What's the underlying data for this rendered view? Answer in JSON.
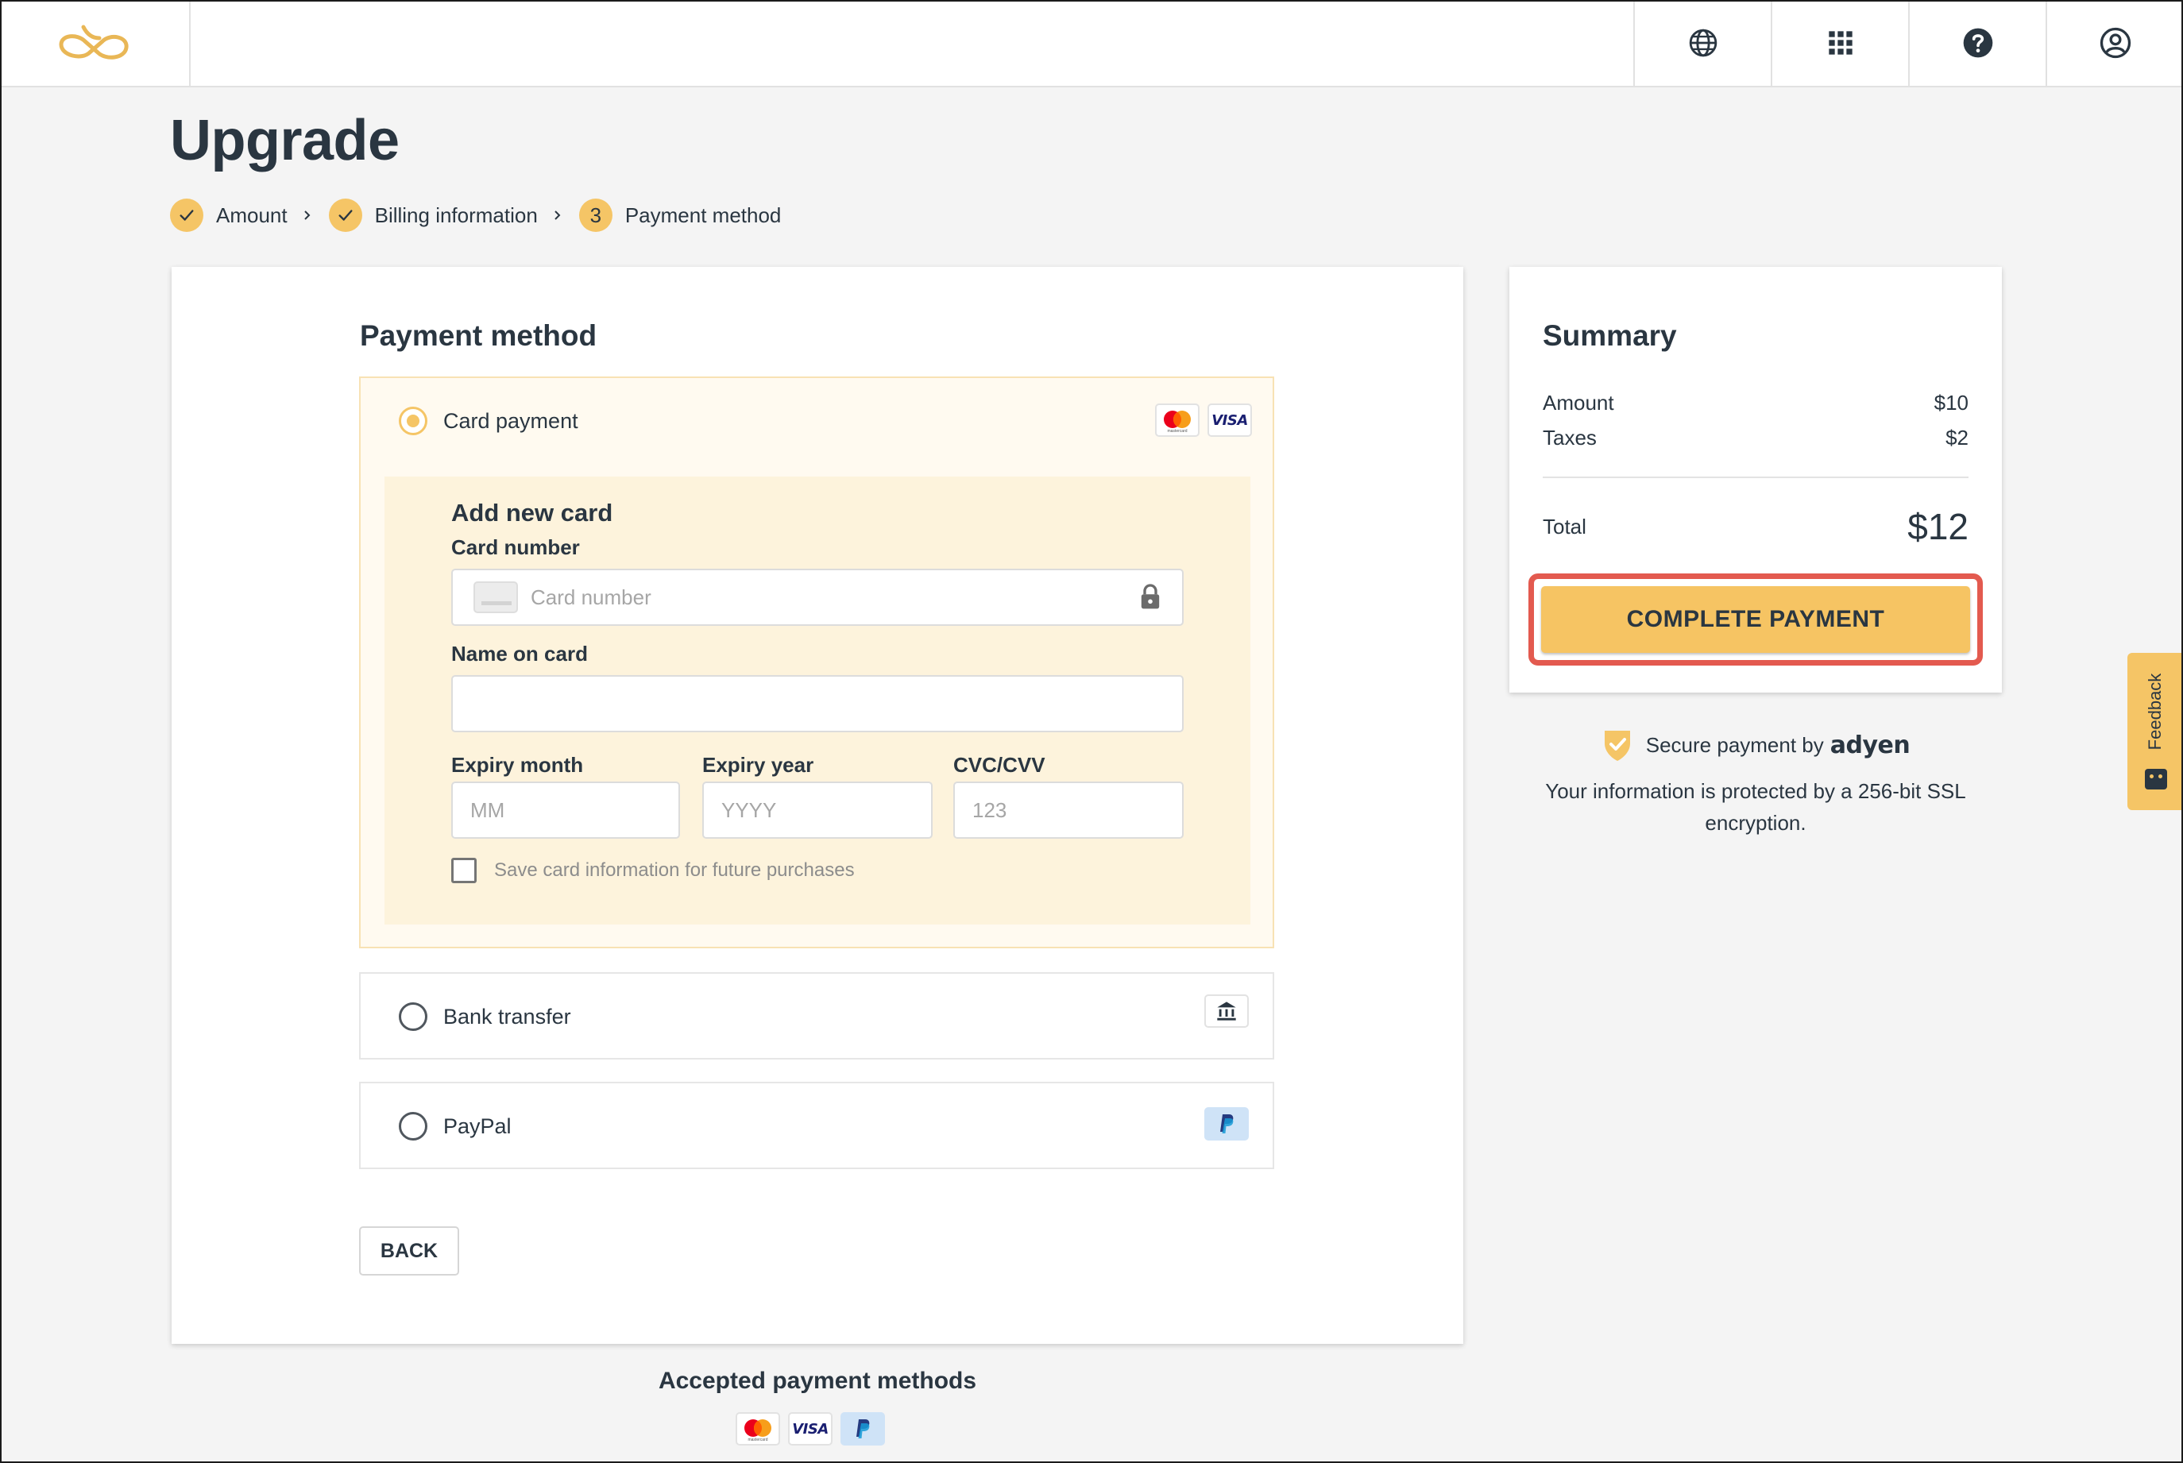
{
  "header": {
    "logo_icon": "infinity-logo",
    "icons": [
      "globe-icon",
      "apps-grid-icon",
      "help-icon",
      "account-icon"
    ]
  },
  "page": {
    "title": "Upgrade"
  },
  "steps": [
    {
      "label": "Amount",
      "status": "done"
    },
    {
      "label": "Billing information",
      "status": "done"
    },
    {
      "label": "Payment method",
      "status": "current",
      "number": "3"
    }
  ],
  "payment": {
    "section_title": "Payment method",
    "card_option": {
      "label": "Card payment",
      "selected": true,
      "brands": [
        "mastercard",
        "VISA"
      ],
      "mastercard_sub": "mastercard",
      "form": {
        "title": "Add new card",
        "card_number_label": "Card number",
        "card_number_placeholder": "Card number",
        "name_label": "Name on card",
        "name_value": "",
        "expiry_month_label": "Expiry month",
        "expiry_month_placeholder": "MM",
        "expiry_year_label": "Expiry year",
        "expiry_year_placeholder": "YYYY",
        "cvc_label": "CVC/CVV",
        "cvc_placeholder": "123",
        "save_card_label": "Save card information for future purchases"
      }
    },
    "bank_option": {
      "label": "Bank transfer",
      "selected": false,
      "icon": "bank-icon"
    },
    "paypal_option": {
      "label": "PayPal",
      "selected": false,
      "icon": "paypal-icon"
    },
    "back_label": "BACK"
  },
  "accepted": {
    "title": "Accepted payment methods",
    "visa": "VISA"
  },
  "summary": {
    "title": "Summary",
    "rows": [
      {
        "label": "Amount",
        "value": "$10"
      },
      {
        "label": "Taxes",
        "value": "$2"
      }
    ],
    "total_label": "Total",
    "total_value": "$12",
    "pay_button": "COMPLETE PAYMENT"
  },
  "secure": {
    "text": "Secure payment by",
    "brand": "adyen",
    "note": "Your information is protected by a 256-bit SSL encryption."
  },
  "feedback": {
    "label": "Feedback"
  },
  "colors": {
    "accent": "#f5c566",
    "text": "#2a3641",
    "highlight": "#e35a4f",
    "selected_bg": "#fffaf0",
    "form_bg": "#fdf3dc"
  }
}
